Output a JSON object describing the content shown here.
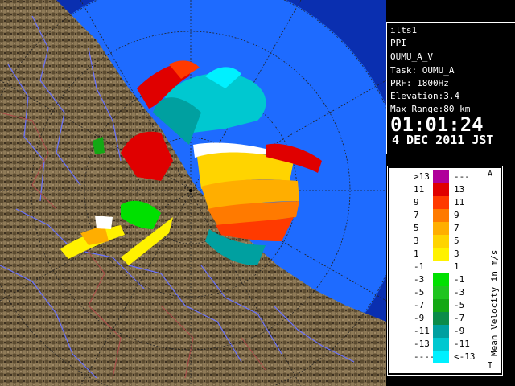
{
  "info": {
    "site": "ilts1",
    "scan_type": "PPI",
    "product": "OUMU_A_V",
    "task": "Task: OUMU_A",
    "prf": "PRF: 1800Hz",
    "elevation": "Elevation:3.4",
    "max_range": "Max Range:80 km",
    "time": "01:01:24",
    "date": "4 DEC 2011 JST"
  },
  "legend": {
    "title": "Mean Velocity in m/s",
    "top_mark": "A",
    "bottom_mark": "T",
    "rows": [
      {
        "low": ">13",
        "high": "---",
        "color": "#b0009a"
      },
      {
        "low": "11",
        "high": "13",
        "color": "#e00000"
      },
      {
        "low": "9",
        "high": "11",
        "color": "#ff3a00"
      },
      {
        "low": "7",
        "high": "9",
        "color": "#ff7a00"
      },
      {
        "low": "5",
        "high": "7",
        "color": "#ffae00"
      },
      {
        "low": "3",
        "high": "5",
        "color": "#ffd400"
      },
      {
        "low": "1",
        "high": "3",
        "color": "#fff200"
      },
      {
        "low": "-1",
        "high": "1",
        "color": "#ffffff"
      },
      {
        "low": "-3",
        "high": "-1",
        "color": "#00e000"
      },
      {
        "low": "-5",
        "high": "-3",
        "color": "#1fc41f"
      },
      {
        "low": "-7",
        "high": "-5",
        "color": "#14a814"
      },
      {
        "low": "-9",
        "high": "-7",
        "color": "#0b8c4a"
      },
      {
        "low": "-11",
        "high": "-9",
        "color": "#00a0a0"
      },
      {
        "low": "-13",
        "high": "-11",
        "color": "#00c8d0"
      },
      {
        "low": "----",
        "high": "<-13",
        "color": "#00f0ff"
      }
    ]
  },
  "colors": {
    "sea": "#1e6bff",
    "outside_range": "#0a2fb0",
    "land": "#6b5a3a",
    "rivers": "#6a73ff",
    "boundaries": "#b04a4a"
  }
}
